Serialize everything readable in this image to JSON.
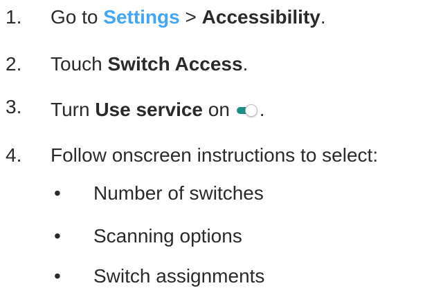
{
  "steps": [
    {
      "number": "1.",
      "parts": {
        "prefix": "Go to ",
        "link": "Settings",
        "separator": " > ",
        "bold": "Accessibility",
        "suffix": "."
      }
    },
    {
      "number": "2.",
      "parts": {
        "prefix": "Touch ",
        "bold": "Switch Access",
        "suffix": "."
      }
    },
    {
      "number": "3.",
      "parts": {
        "prefix": "Turn ",
        "bold": "Use service",
        "mid": " on ",
        "suffix": "."
      }
    },
    {
      "number": "4.",
      "parts": {
        "text": "Follow onscreen instructions to select:"
      }
    }
  ],
  "sub_items": [
    {
      "bullet": "•",
      "text": "Number of switches"
    },
    {
      "bullet": "•",
      "text": "Scanning options"
    },
    {
      "bullet": "•",
      "text": "Switch assignments"
    }
  ],
  "toggle": {
    "icon": "toggle-switch-icon",
    "state": "on",
    "accent_color": "#1b8f86"
  },
  "colors": {
    "text": "#2a2a2a",
    "link": "#42a5f5"
  }
}
